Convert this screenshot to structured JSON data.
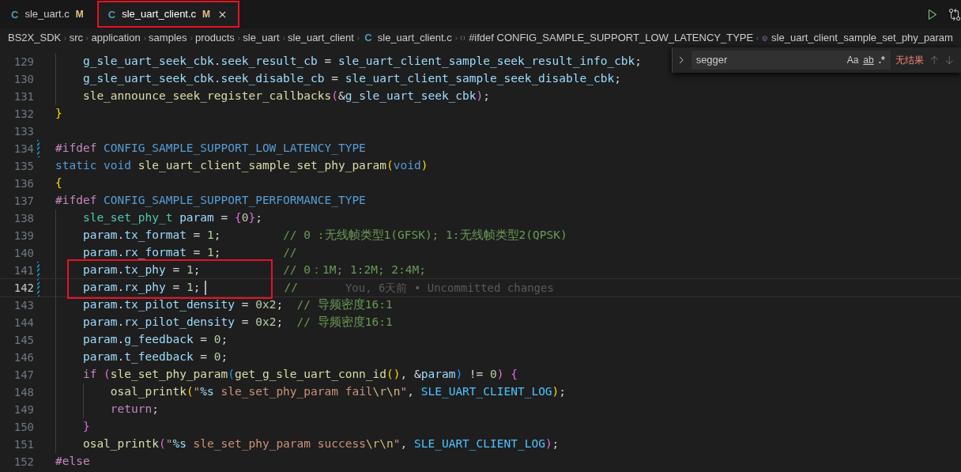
{
  "tabs": [
    {
      "icon": "C",
      "label": "sle_uart.c",
      "badge": "M",
      "selected": false,
      "boxed": false,
      "closable": false
    },
    {
      "icon": "C",
      "label": "sle_uart_client.c",
      "badge": "M",
      "selected": true,
      "boxed": true,
      "closable": true
    }
  ],
  "breadcrumbs": [
    {
      "label": "BS2X_SDK",
      "kind": "folder"
    },
    {
      "label": "src",
      "kind": "folder"
    },
    {
      "label": "application",
      "kind": "folder"
    },
    {
      "label": "samples",
      "kind": "folder"
    },
    {
      "label": "products",
      "kind": "folder"
    },
    {
      "label": "sle_uart",
      "kind": "folder"
    },
    {
      "label": "sle_uart_client",
      "kind": "folder"
    },
    {
      "icon": "C",
      "label": "sle_uart_client.c",
      "kind": "file"
    },
    {
      "label": "#ifdef CONFIG_SAMPLE_SUPPORT_LOW_LATENCY_TYPE",
      "kind": "block"
    },
    {
      "label": "sle_uart_client_sample_set_phy_param",
      "kind": "function"
    }
  ],
  "find": {
    "value": "segger",
    "options": [
      {
        "label": "Aa",
        "kind": "case"
      },
      {
        "label": "ab",
        "kind": "word"
      },
      {
        "label": ".*",
        "kind": "regex"
      }
    ],
    "result": "无结果"
  },
  "lines": [
    {
      "number": "129",
      "modified": false,
      "current": false,
      "boxed": false,
      "tokens": [
        {
          "text": "    g_sle_uart_seek_cbk",
          "kind": "var"
        },
        {
          "text": ".",
          "kind": "p"
        },
        {
          "text": "seek_result_cb",
          "kind": "var"
        },
        {
          "text": " = ",
          "kind": "p"
        },
        {
          "text": "sle_uart_client_sample_seek_result_info_cbk",
          "kind": "var"
        },
        {
          "text": ";",
          "kind": "p"
        }
      ]
    },
    {
      "number": "130",
      "modified": false,
      "current": false,
      "boxed": false,
      "tokens": [
        {
          "text": "    g_sle_uart_seek_cbk",
          "kind": "var"
        },
        {
          "text": ".",
          "kind": "p"
        },
        {
          "text": "seek_disable_cb",
          "kind": "var"
        },
        {
          "text": " = ",
          "kind": "p"
        },
        {
          "text": "sle_uart_client_sample_seek_disable_cbk",
          "kind": "var"
        },
        {
          "text": ";",
          "kind": "p"
        }
      ]
    },
    {
      "number": "131",
      "modified": false,
      "current": false,
      "boxed": false,
      "tokens": [
        {
          "text": "    sle_announce_seek_register_callbacks",
          "kind": "fn"
        },
        {
          "text": "(",
          "kind": "b2"
        },
        {
          "text": "&",
          "kind": "p"
        },
        {
          "text": "g_sle_uart_seek_cbk",
          "kind": "var"
        },
        {
          "text": ")",
          "kind": "b2"
        },
        {
          "text": ";",
          "kind": "p"
        }
      ]
    },
    {
      "number": "132",
      "modified": false,
      "current": false,
      "boxed": false,
      "tokens": [
        {
          "text": "}",
          "kind": "b1"
        }
      ]
    },
    {
      "number": "133",
      "modified": false,
      "current": false,
      "boxed": false
    },
    {
      "number": "134",
      "modified": true,
      "current": false,
      "boxed": false,
      "tokens": [
        {
          "text": "#ifdef ",
          "kind": "pre"
        },
        {
          "text": "CONFIG_SAMPLE_SUPPORT_LOW_LATENCY_TYPE",
          "kind": "kw"
        }
      ]
    },
    {
      "number": "135",
      "modified": false,
      "current": false,
      "boxed": false,
      "tokens": [
        {
          "text": "static void ",
          "kind": "kw"
        },
        {
          "text": "sle_uart_client_sample_set_phy_param",
          "kind": "fn"
        },
        {
          "text": "(",
          "kind": "b1"
        },
        {
          "text": "void",
          "kind": "kw"
        },
        {
          "text": ")",
          "kind": "b1"
        }
      ]
    },
    {
      "number": "136",
      "modified": false,
      "current": false,
      "boxed": false,
      "tokens": [
        {
          "text": "{",
          "kind": "b1"
        }
      ]
    },
    {
      "number": "137",
      "modified": false,
      "current": false,
      "boxed": false,
      "tokens": [
        {
          "text": "#ifdef ",
          "kind": "pre"
        },
        {
          "text": "CONFIG_SAMPLE_SUPPORT_PERFORMANCE_TYPE",
          "kind": "kw"
        }
      ]
    },
    {
      "number": "138",
      "modified": false,
      "current": false,
      "boxed": false,
      "tokens": [
        {
          "text": "    sle_set_phy_t",
          "kind": "type"
        },
        {
          "text": " param",
          "kind": "var"
        },
        {
          "text": " = ",
          "kind": "p"
        },
        {
          "text": "{",
          "kind": "b2"
        },
        {
          "text": "0",
          "kind": "num"
        },
        {
          "text": "}",
          "kind": "b2"
        },
        {
          "text": ";",
          "kind": "p"
        }
      ]
    },
    {
      "number": "139",
      "modified": false,
      "current": false,
      "boxed": false,
      "tokens": [
        {
          "text": "    param",
          "kind": "var"
        },
        {
          "text": ".",
          "kind": "p"
        },
        {
          "text": "tx_format",
          "kind": "var"
        },
        {
          "text": " = ",
          "kind": "p"
        },
        {
          "text": "1",
          "kind": "num"
        },
        {
          "text": ";",
          "kind": "p"
        },
        {
          "text": "         // 0 :无线帧类型1(GFSK); 1:无线帧类型2(QPSK)",
          "kind": "cmt"
        }
      ]
    },
    {
      "number": "140",
      "modified": false,
      "current": false,
      "boxed": false,
      "tokens": [
        {
          "text": "    param",
          "kind": "var"
        },
        {
          "text": ".",
          "kind": "p"
        },
        {
          "text": "rx_format",
          "kind": "var"
        },
        {
          "text": " = ",
          "kind": "p"
        },
        {
          "text": "1",
          "kind": "num"
        },
        {
          "text": ";",
          "kind": "p"
        },
        {
          "text": "         //",
          "kind": "cmt"
        }
      ]
    },
    {
      "number": "141",
      "modified": true,
      "current": false,
      "boxed": true,
      "tokens": [
        {
          "text": "    param",
          "kind": "var"
        },
        {
          "text": ".",
          "kind": "p"
        },
        {
          "text": "tx_phy",
          "kind": "var"
        },
        {
          "text": " = ",
          "kind": "p"
        },
        {
          "text": "1",
          "kind": "num"
        },
        {
          "text": ";",
          "kind": "p"
        },
        {
          "text": "            // 0：1M; 1:2M; 2:4M;",
          "kind": "cmt"
        }
      ]
    },
    {
      "number": "142",
      "modified": true,
      "current": true,
      "boxed": true,
      "blame": "You, 6天前 • Uncommitted changes",
      "tokens": [
        {
          "text": "    param",
          "kind": "var"
        },
        {
          "text": ".",
          "kind": "p"
        },
        {
          "text": "rx_phy",
          "kind": "var"
        },
        {
          "text": " = ",
          "kind": "p"
        },
        {
          "text": "1",
          "kind": "num"
        },
        {
          "text": ";",
          "kind": "p",
          "caret": true
        },
        {
          "text": "           //",
          "kind": "cmt"
        }
      ]
    },
    {
      "number": "143",
      "modified": false,
      "current": false,
      "boxed": false,
      "tokens": [
        {
          "text": "    param",
          "kind": "var"
        },
        {
          "text": ".",
          "kind": "p"
        },
        {
          "text": "tx_pilot_density",
          "kind": "var"
        },
        {
          "text": " = ",
          "kind": "p"
        },
        {
          "text": "0x2",
          "kind": "num"
        },
        {
          "text": ";",
          "kind": "p"
        },
        {
          "text": "  // 导频密度16:1",
          "kind": "cmt"
        }
      ]
    },
    {
      "number": "144",
      "modified": false,
      "current": false,
      "boxed": false,
      "tokens": [
        {
          "text": "    param",
          "kind": "var"
        },
        {
          "text": ".",
          "kind": "p"
        },
        {
          "text": "rx_pilot_density",
          "kind": "var"
        },
        {
          "text": " = ",
          "kind": "p"
        },
        {
          "text": "0x2",
          "kind": "num"
        },
        {
          "text": ";",
          "kind": "p"
        },
        {
          "text": "  // 导频密度16:1",
          "kind": "cmt"
        }
      ]
    },
    {
      "number": "145",
      "modified": false,
      "current": false,
      "boxed": false,
      "tokens": [
        {
          "text": "    param",
          "kind": "var"
        },
        {
          "text": ".",
          "kind": "p"
        },
        {
          "text": "g_feedback",
          "kind": "var"
        },
        {
          "text": " = ",
          "kind": "p"
        },
        {
          "text": "0",
          "kind": "num"
        },
        {
          "text": ";",
          "kind": "p"
        }
      ]
    },
    {
      "number": "146",
      "modified": false,
      "current": false,
      "boxed": false,
      "tokens": [
        {
          "text": "    param",
          "kind": "var"
        },
        {
          "text": ".",
          "kind": "p"
        },
        {
          "text": "t_feedback",
          "kind": "var"
        },
        {
          "text": " = ",
          "kind": "p"
        },
        {
          "text": "0",
          "kind": "num"
        },
        {
          "text": ";",
          "kind": "p"
        }
      ]
    },
    {
      "number": "147",
      "modified": false,
      "current": false,
      "boxed": false,
      "tokens": [
        {
          "text": "    if ",
          "kind": "ctl"
        },
        {
          "text": "(",
          "kind": "b2"
        },
        {
          "text": "sle_set_phy_param",
          "kind": "fn"
        },
        {
          "text": "(",
          "kind": "b3"
        },
        {
          "text": "get_g_sle_uart_conn_id",
          "kind": "fn"
        },
        {
          "text": "()",
          "kind": "b1"
        },
        {
          "text": ", &",
          "kind": "p"
        },
        {
          "text": "param",
          "kind": "var"
        },
        {
          "text": ")",
          "kind": "b3"
        },
        {
          "text": " != ",
          "kind": "p"
        },
        {
          "text": "0",
          "kind": "num"
        },
        {
          "text": ")",
          "kind": "b2"
        },
        {
          "text": " {",
          "kind": "b2"
        }
      ]
    },
    {
      "number": "148",
      "modified": false,
      "current": false,
      "boxed": false,
      "tokens": [
        {
          "text": "        osal_printk",
          "kind": "fn"
        },
        {
          "text": "(",
          "kind": "b1"
        },
        {
          "text": "\"",
          "kind": "str"
        },
        {
          "text": "%s",
          "kind": "fmt"
        },
        {
          "text": " sle_set_phy_param fail",
          "kind": "str"
        },
        {
          "text": "\\r\\n",
          "kind": "esc"
        },
        {
          "text": "\"",
          "kind": "str"
        },
        {
          "text": ", ",
          "kind": "p"
        },
        {
          "text": "SLE_UART_CLIENT_LOG",
          "kind": "const"
        },
        {
          "text": ")",
          "kind": "b1"
        },
        {
          "text": ";",
          "kind": "p"
        }
      ]
    },
    {
      "number": "149",
      "modified": false,
      "current": false,
      "boxed": false,
      "tokens": [
        {
          "text": "        return",
          "kind": "ctl"
        },
        {
          "text": ";",
          "kind": "p"
        }
      ]
    },
    {
      "number": "150",
      "modified": false,
      "current": false,
      "boxed": false,
      "tokens": [
        {
          "text": "    }",
          "kind": "b2"
        }
      ]
    },
    {
      "number": "151",
      "modified": false,
      "current": false,
      "boxed": false,
      "tokens": [
        {
          "text": "    osal_printk",
          "kind": "fn"
        },
        {
          "text": "(",
          "kind": "b2"
        },
        {
          "text": "\"",
          "kind": "str"
        },
        {
          "text": "%s",
          "kind": "fmt"
        },
        {
          "text": " sle_set_phy_param success",
          "kind": "str"
        },
        {
          "text": "\\r\\n",
          "kind": "esc"
        },
        {
          "text": "\"",
          "kind": "str"
        },
        {
          "text": ", ",
          "kind": "p"
        },
        {
          "text": "SLE_UART_CLIENT_LOG",
          "kind": "const"
        },
        {
          "text": ")",
          "kind": "b2"
        },
        {
          "text": ";",
          "kind": "p"
        }
      ]
    },
    {
      "number": "152",
      "modified": false,
      "current": false,
      "boxed": false,
      "tokens": [
        {
          "text": "#else",
          "kind": "pre"
        }
      ]
    }
  ]
}
